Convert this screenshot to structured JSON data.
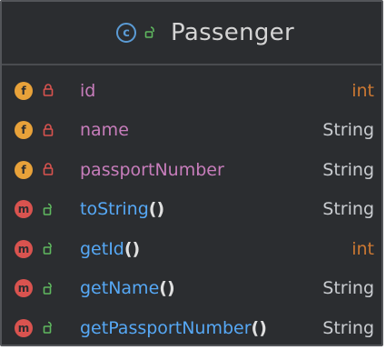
{
  "class": {
    "icon": "class-icon",
    "icon_letter": "c",
    "visibility_icon": "public-unlocked-icon",
    "name": "Passenger"
  },
  "members": [
    {
      "kind": "field",
      "kind_letter": "f",
      "visibility": "private",
      "name": "id",
      "params": "",
      "type": "int",
      "type_kind": "primitive"
    },
    {
      "kind": "field",
      "kind_letter": "f",
      "visibility": "private",
      "name": "name",
      "params": "",
      "type": "String",
      "type_kind": "reference"
    },
    {
      "kind": "field",
      "kind_letter": "f",
      "visibility": "private",
      "name": "passportNumber",
      "params": "",
      "type": "String",
      "type_kind": "reference"
    },
    {
      "kind": "method",
      "kind_letter": "m",
      "visibility": "public",
      "name": "toString",
      "params": "()",
      "type": "String",
      "type_kind": "reference"
    },
    {
      "kind": "method",
      "kind_letter": "m",
      "visibility": "public",
      "name": "getId",
      "params": "()",
      "type": "int",
      "type_kind": "primitive"
    },
    {
      "kind": "method",
      "kind_letter": "m",
      "visibility": "public",
      "name": "getName",
      "params": "()",
      "type": "String",
      "type_kind": "reference"
    },
    {
      "kind": "method",
      "kind_letter": "m",
      "visibility": "public",
      "name": "getPassportNumber",
      "params": "()",
      "type": "String",
      "type_kind": "reference"
    }
  ],
  "colors": {
    "background": "#2b2d30",
    "border": "#535559",
    "field_name": "#c77dbb",
    "method_name": "#56a8f5",
    "field_icon": "#e8a23a",
    "method_icon": "#d9534f",
    "class_icon": "#5b9bd5",
    "private_lock": "#d9534f",
    "public_lock": "#5fb85f",
    "primitive_type": "#cc7832",
    "reference_type": "#c9ccd0"
  }
}
